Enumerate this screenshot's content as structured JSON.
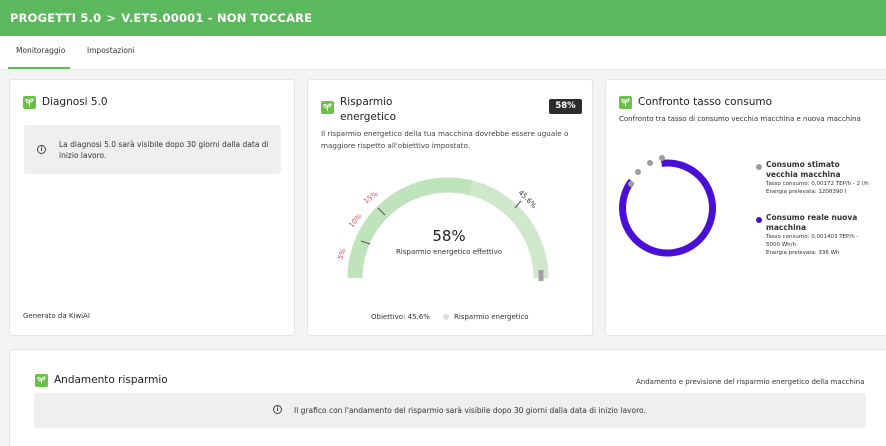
{
  "breadcrumb": {
    "section": "PROGETTI 5.0",
    "separator": ">",
    "project": "V.ETS.00001 - NON TOCCARE"
  },
  "tabs": [
    {
      "label": "Monitoraggio"
    },
    {
      "label": "Impostazioni"
    }
  ],
  "colors": {
    "brand": "#5cb85c",
    "gauge_track": "#cfe8cc",
    "gauge_fill": "#bfe3bb",
    "old_machine": "#9e9e9e",
    "new_machine": "#4a0fd6"
  },
  "diagnosi": {
    "title": "Diagnosi 5.0",
    "info_icon": "info-icon",
    "info": "La diagnosi 5.0 sarà visibile dopo 30 giorni dalla data di inizio lavoro.",
    "footer": "Generato da KiwiAI"
  },
  "risparmio": {
    "title_line1": "Risparmio",
    "title_line2": "energetico",
    "badge": "58%",
    "description": "Il risparmio energetico della tua macchina dovrebbe essere uguale o maggiore rispetto all'obiettivo impostato.",
    "gauge_value": "58%",
    "gauge_value_num": 58,
    "gauge_caption": "Risparmio energetico effettivo",
    "tick_5": "5%",
    "tick_10": "10%",
    "tick_15": "15%",
    "tick_target": "45.6%",
    "target_label": "Obiettivo: 45.6%",
    "legend_label": "Risparmio energetico"
  },
  "confronto": {
    "title": "Confronto tasso consumo",
    "subtitle": "Confronto tra tasso di consumo vecchia macchina e nuova macchina",
    "old_name": "Consumo stimato vecchia macchina",
    "old_rate": "Tasso consumo: 0,00172 TEP/h - 2 l/h",
    "old_energy": "Energia prelevata: 1200390 l",
    "new_name": "Consumo reale nuova macchina",
    "new_rate": "Tasso consumo: 0,001403 TEP/h - 5000 Wh/h",
    "new_energy": "Energia prelevata: 336 Wh"
  },
  "andamento": {
    "title": "Andamento risparmio",
    "subtitle": "Andamento e previsione del risparmio energetico della macchina",
    "info": "Il grafico con l'andamento del risparmio sarà visibile dopo 30 giorni dalla data di inizio lavoro."
  }
}
